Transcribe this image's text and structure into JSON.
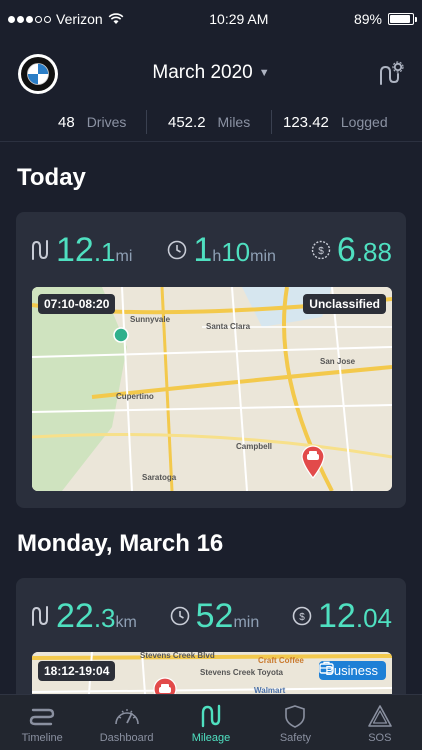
{
  "status_bar": {
    "carrier": "Verizon",
    "time": "10:29 AM",
    "battery": "89%",
    "battery_level": 0.89
  },
  "header": {
    "month": "March 2020",
    "logo": "bmw-logo-icon",
    "settings_icon": "route-settings-icon"
  },
  "summary": [
    {
      "value": "48",
      "unit": "Drives"
    },
    {
      "value": "452.2",
      "unit": "Miles"
    },
    {
      "value": "123.42",
      "unit": "Logged"
    }
  ],
  "sections": [
    {
      "title": "Today",
      "distance": {
        "int": "12",
        "dec": ".1",
        "unit": "mi"
      },
      "duration": {
        "h": "1",
        "h_unit": "h",
        "m": "10",
        "m_unit": "min"
      },
      "value": {
        "int": "6",
        "dec": ".88"
      },
      "time_range": "07:10-08:20",
      "classification": "Unclassified",
      "map_labels": [
        "Sunnyvale",
        "Santa Clara",
        "San Jose",
        "Cupertino",
        "Campbell",
        "Saratoga"
      ]
    },
    {
      "title": "Monday, March 16",
      "distance": {
        "int": "22",
        "dec": ".3",
        "unit": "km"
      },
      "duration": {
        "m": "52",
        "m_unit": "min"
      },
      "value": {
        "int": "12",
        "dec": ".04"
      },
      "time_range": "18:12-19:04",
      "classification": "Business",
      "map_labels": [
        "Stevens Creek Blvd",
        "Stevens Creek Toyota",
        "Craft Coffee",
        "Walmart"
      ]
    }
  ],
  "tabs": [
    {
      "label": "Timeline",
      "icon": "timeline-icon"
    },
    {
      "label": "Dashboard",
      "icon": "dashboard-icon"
    },
    {
      "label": "Mileage",
      "icon": "mileage-icon",
      "active": true
    },
    {
      "label": "Safety",
      "icon": "safety-shield-icon"
    },
    {
      "label": "SOS",
      "icon": "sos-warning-icon"
    }
  ],
  "colors": {
    "accent": "#4fe0c0",
    "background": "#1b1f2c",
    "card": "#2a2f3c",
    "business": "#1e80d6"
  }
}
